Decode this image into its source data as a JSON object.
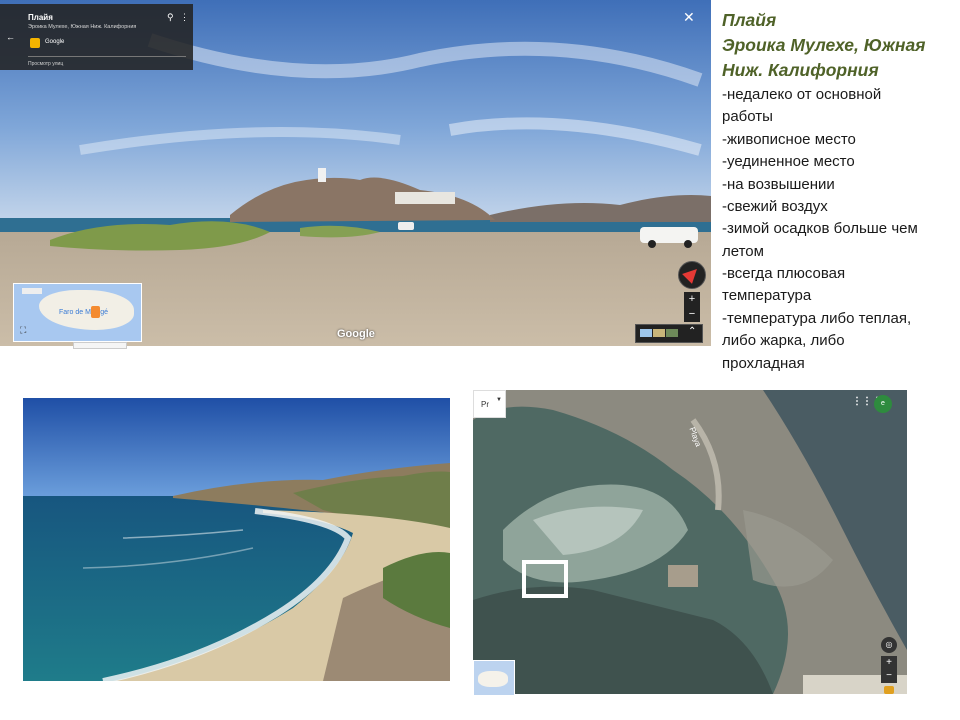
{
  "street_view": {
    "card": {
      "title": "Плайя",
      "subtitle": "Эроика Мулехе, Южная Ниж. Калифорния",
      "provider": "Google",
      "link": "Просмотр улиц"
    },
    "watermark": "Google",
    "close_icon": "close-icon",
    "minimap": {
      "label": "Faro de Mulegé"
    }
  },
  "text_column": {
    "heading": [
      "Плайя",
      "Эроика Мулехе, Южная",
      "Ниж. Калифорния"
    ],
    "lines": [
      "-недалеко от основной",
      "работы",
      "-живописное место",
      "-уединенное место",
      "-на возвышении",
      "-свежий воздух",
      "-зимой осадков больше чем",
      "летом",
      "-всегда плюсовая",
      "температура",
      "-температура либо теплая,",
      "либо жарка, либо",
      "прохладная"
    ]
  },
  "satellite_map": {
    "select_value": "Pr",
    "road_label": "Playa",
    "avatar_letter": "e"
  },
  "colors": {
    "heading": "#4f6228",
    "sky": "#5a8fd6",
    "sea": "#1e6f98"
  }
}
